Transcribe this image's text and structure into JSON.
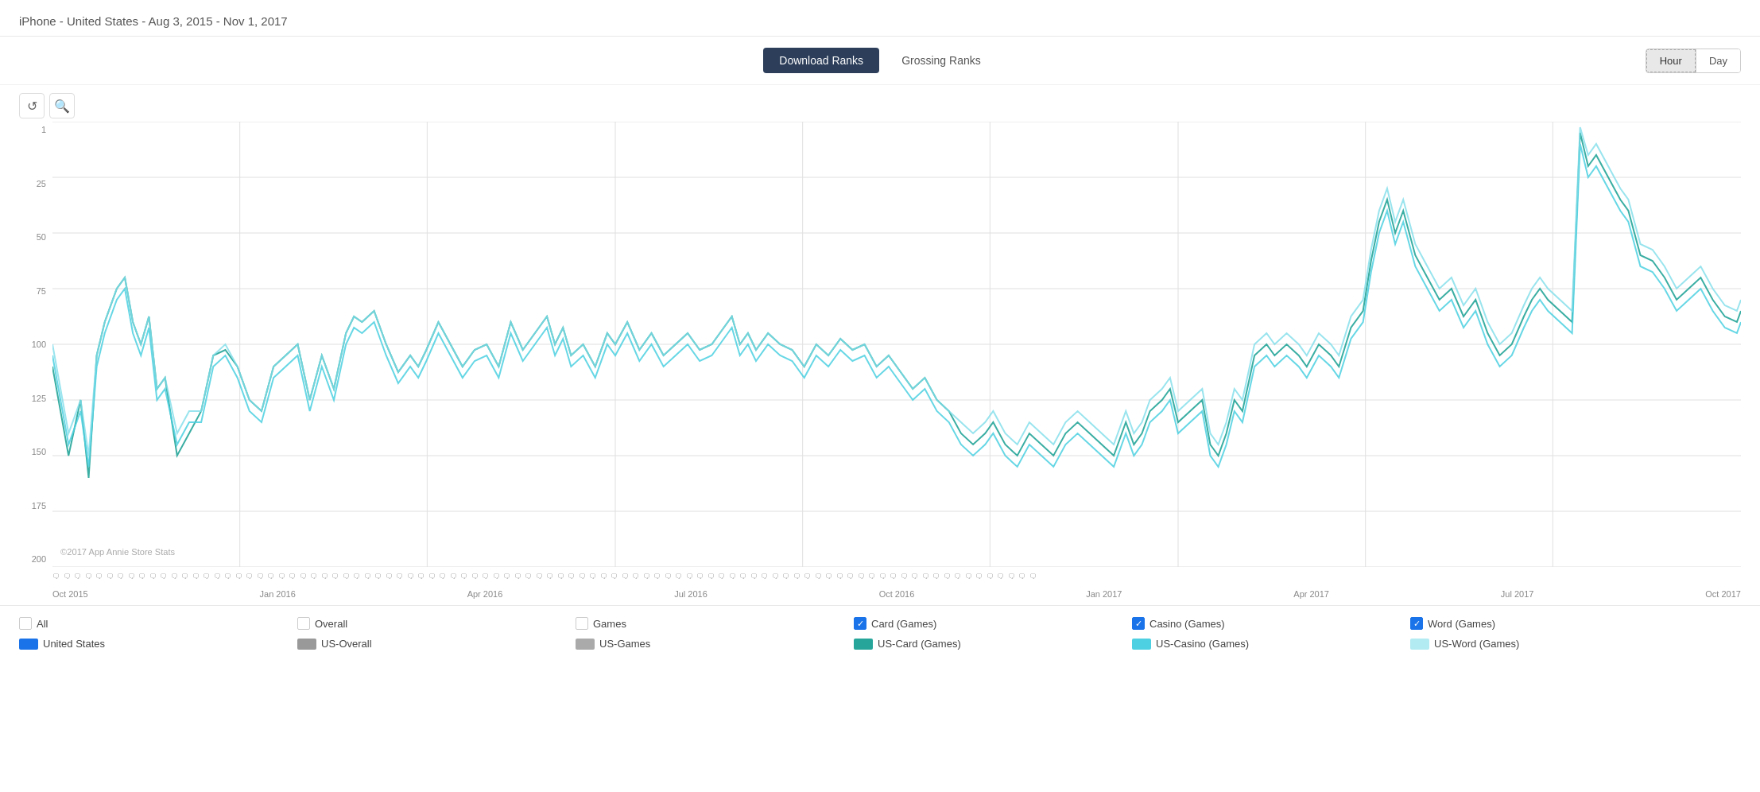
{
  "header": {
    "title": "iPhone - United States - Aug 3, 2015 - Nov 1, 2017"
  },
  "tabs": {
    "download_ranks": "Download Ranks",
    "grossing_ranks": "Grossing Ranks",
    "active": "download"
  },
  "time_toggle": {
    "hour": "Hour",
    "day": "Day",
    "selected": "hour"
  },
  "chart_controls": {
    "reset_icon": "↺",
    "zoom_icon": "⊕"
  },
  "y_axis": {
    "labels": [
      "1",
      "25",
      "50",
      "75",
      "100",
      "125",
      "150",
      "175",
      "200"
    ]
  },
  "x_axis": {
    "labels": [
      "Oct 2015",
      "Jan 2016",
      "Apr 2016",
      "Jul 2016",
      "Oct 2016",
      "Jan 2017",
      "Apr 2017",
      "Jul 2017",
      "Oct 2017"
    ]
  },
  "copyright": "©2017 App Annie Store Stats",
  "legend": {
    "checkboxes": [
      {
        "label": "All",
        "checked": false
      },
      {
        "label": "Overall",
        "checked": false
      },
      {
        "label": "Games",
        "checked": false
      },
      {
        "label": "Card (Games)",
        "checked": true
      },
      {
        "label": "Casino (Games)",
        "checked": true
      },
      {
        "label": "Word (Games)",
        "checked": true
      }
    ],
    "swatches": [
      {
        "label": "United States",
        "color": "#1a73e8"
      },
      {
        "label": "US-Overall",
        "color": "#999"
      },
      {
        "label": "US-Games",
        "color": "#aaa"
      },
      {
        "label": "US-Card (Games)",
        "color": "#26a69a"
      },
      {
        "label": "US-Casino (Games)",
        "color": "#4dd0e1"
      },
      {
        "label": "US-Word (Games)",
        "color": "#b2ebf2"
      }
    ]
  }
}
